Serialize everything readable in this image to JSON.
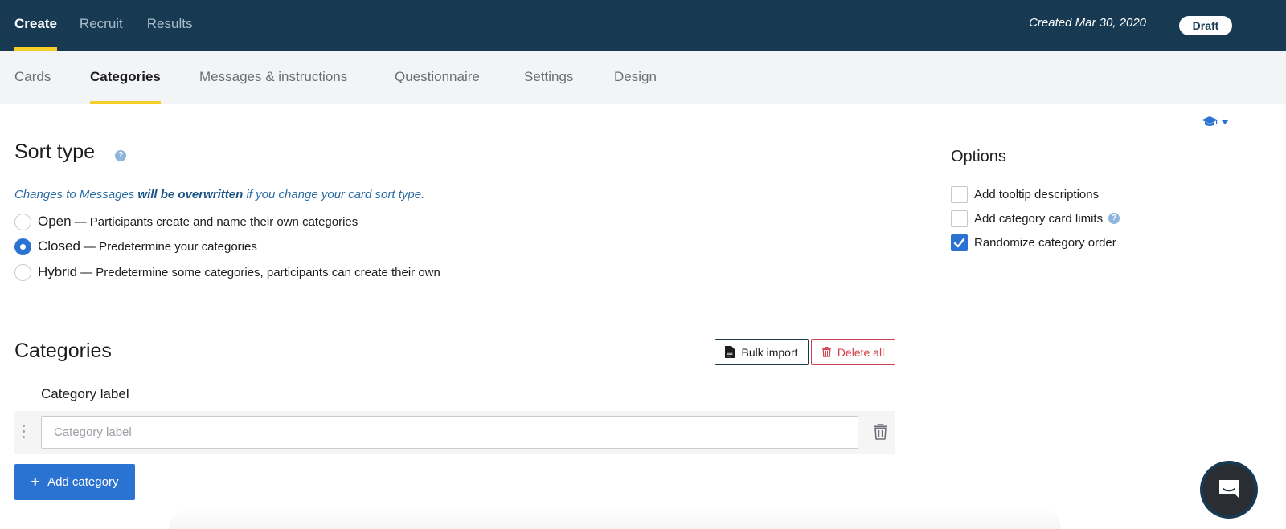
{
  "top_nav": {
    "tabs": [
      {
        "label": "Create",
        "active": true
      },
      {
        "label": "Recruit",
        "active": false
      },
      {
        "label": "Results",
        "active": false
      }
    ],
    "created_text": "Created Mar 30, 2020",
    "status_badge": "Draft"
  },
  "sub_nav": {
    "tabs": [
      {
        "label": "Cards",
        "active": false
      },
      {
        "label": "Categories",
        "active": true
      },
      {
        "label": "Messages & instructions",
        "active": false
      },
      {
        "label": "Questionnaire",
        "active": false
      },
      {
        "label": "Settings",
        "active": false
      },
      {
        "label": "Design",
        "active": false
      }
    ]
  },
  "sort_type": {
    "title": "Sort type",
    "warning_prefix": "Changes to Messages ",
    "warning_bold": "will be overwritten",
    "warning_suffix": " if you change your card sort type.",
    "options": [
      {
        "title": "Open",
        "desc": "— Participants create and name their own categories",
        "selected": false
      },
      {
        "title": "Closed",
        "desc": "— Predetermine your categories",
        "selected": true
      },
      {
        "title": "Hybrid",
        "desc": "— Predetermine some categories, participants can create their own",
        "selected": false
      }
    ]
  },
  "options": {
    "title": "Options",
    "items": [
      {
        "label": "Add tooltip descriptions",
        "checked": false
      },
      {
        "label": "Add category card limits",
        "checked": false
      },
      {
        "label": "Randomize category order",
        "checked": true
      }
    ]
  },
  "categories": {
    "title": "Categories",
    "bulk_import_label": "Bulk import",
    "delete_all_label": "Delete all",
    "column_label": "Category label",
    "rows": [
      {
        "value": "",
        "placeholder": "Category label"
      }
    ],
    "add_label": "Add category"
  },
  "colors": {
    "navy": "#173a52",
    "accent_yellow": "#f5cf28",
    "primary_blue": "#2b73d2",
    "danger_red": "#d0414b"
  }
}
